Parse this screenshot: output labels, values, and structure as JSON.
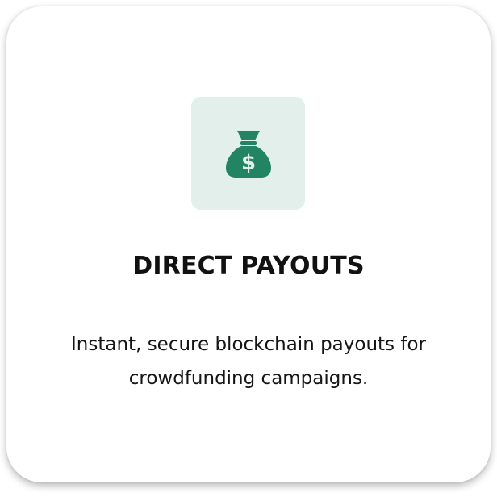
{
  "card": {
    "icon": "money-bag-dollar-icon",
    "icon_color": "#228463",
    "icon_tile_color": "#e3efeb",
    "title": "DIRECT PAYOUTS",
    "description": "Instant, secure blockchain payouts for crowdfunding campaigns."
  }
}
